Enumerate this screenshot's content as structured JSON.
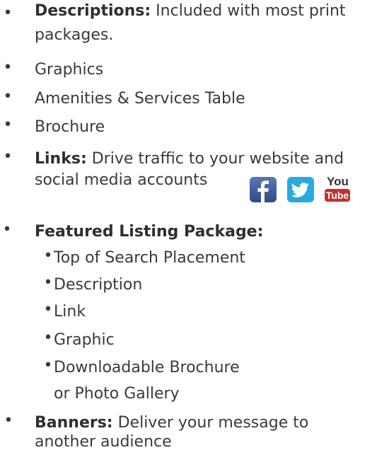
{
  "bullet_glyph": "•",
  "sub_bullet_glyph": "•",
  "items": [
    {
      "bold": "Descriptions:",
      "text": " Included with most print",
      "text2": "packages."
    },
    {
      "text": "Graphics"
    },
    {
      "text": "Amenities & Services Table"
    },
    {
      "text": "Brochure"
    },
    {
      "bold": "Links:",
      "text": " Drive traffic to your website and",
      "text2": "social media accounts"
    },
    {
      "bold": "Featured Listing Package:"
    },
    {
      "bold": "Banners:",
      "text": " Deliver your message to",
      "text2": "another audience"
    }
  ],
  "featured_sub": [
    {
      "text": "Top of Search Placement"
    },
    {
      "text": "Description"
    },
    {
      "text": "Link"
    },
    {
      "text": "Graphic"
    },
    {
      "text": "Downloadable Brochure",
      "text2": "or Photo Gallery"
    }
  ],
  "social_icons": [
    {
      "name": "facebook-icon",
      "color": "#3b5a9a"
    },
    {
      "name": "twitter-icon",
      "color": "#2aa9e0"
    },
    {
      "name": "youtube-icon",
      "color": "#c4302b",
      "top_text": "You",
      "bottom_text": "Tube"
    }
  ]
}
